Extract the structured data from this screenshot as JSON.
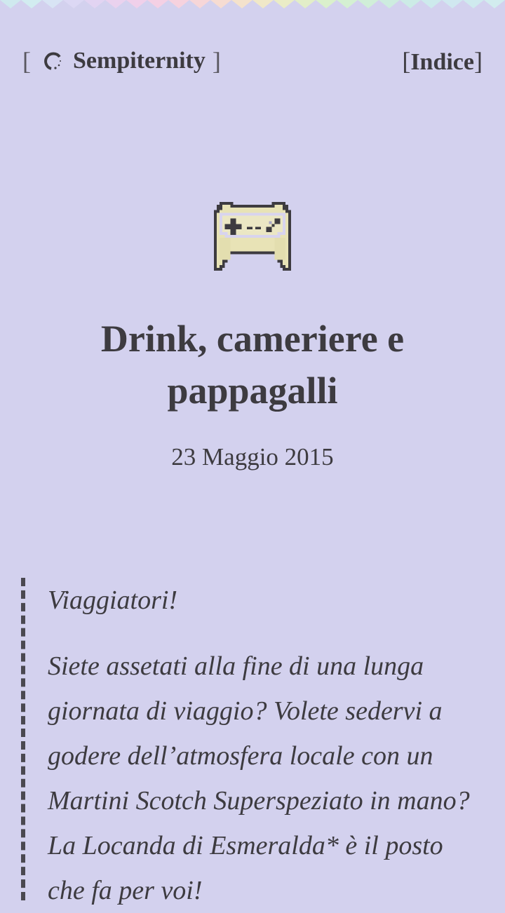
{
  "header": {
    "site_bracket_open": "[",
    "site_name": "Sempiternity",
    "site_bracket_close": "]",
    "site_icon": "spinner-icon",
    "index_bracket_open": "[",
    "index_label": "Indice",
    "index_bracket_close": "]"
  },
  "post": {
    "icon": "game-controller-icon",
    "title": "Drink, cameriere e pappagalli",
    "date": "23 Maggio 2015"
  },
  "quote": {
    "greeting": "Viaggiatori!",
    "body": "Siete assetati alla fine di una lunga giornata di viaggio? Volete sedervi a godere dell’atmosfera locale con un Martini Scotch Superspeziato in mano? La Locanda di Esmeralda* è il posto che fa per voi!"
  },
  "colors": {
    "background": "#d3d1ee",
    "text": "#3d3b40",
    "controller_fill": "#e8e3b6",
    "controller_outline": "#3d3b40"
  }
}
